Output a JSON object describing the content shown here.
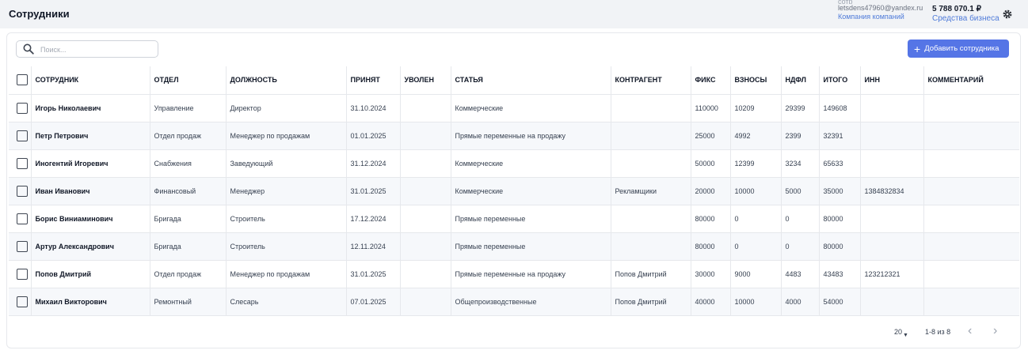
{
  "header": {
    "title": "Сотрудники",
    "account_top": "сотр",
    "email": "letsdens47960@yandex.ru",
    "company_link": "Компания компаний",
    "balance": "5 788 070.1 ₽",
    "funds_link": "Средства бизнеса",
    "settings_icon": "gear-icon"
  },
  "toolbar": {
    "search_placeholder": "Поиск...",
    "search_value": "",
    "add_button": "Добавить сотрудника"
  },
  "table": {
    "columns": [
      "СОТРУДНИК",
      "ОТДЕЛ",
      "ДОЛЖНОСТЬ",
      "ПРИНЯТ",
      "УВОЛЕН",
      "СТАТЬЯ",
      "КОНТРАГЕНТ",
      "ФИКС",
      "ВЗНОСЫ",
      "НДФЛ",
      "ИТОГО",
      "ИНН",
      "КОММЕНТАРИЙ"
    ],
    "rows": [
      [
        "Игорь Николаевич",
        "Управление",
        "Директор",
        "31.10.2024",
        "",
        "Коммерческие",
        "",
        "110000",
        "10209",
        "29399",
        "149608",
        "",
        ""
      ],
      [
        "Петр Петрович",
        "Отдел продаж",
        "Менеджер по продажам",
        "01.01.2025",
        "",
        "Прямые переменные на продажу",
        "",
        "25000",
        "4992",
        "2399",
        "32391",
        "",
        ""
      ],
      [
        "Иногентий Игоревич",
        "Снабжения",
        "Заведующий",
        "31.12.2024",
        "",
        "Коммерческие",
        "",
        "50000",
        "12399",
        "3234",
        "65633",
        "",
        ""
      ],
      [
        "Иван Иванович",
        "Финансовый",
        "Менеджер",
        "31.01.2025",
        "",
        "Коммерческие",
        "Рекламщики",
        "20000",
        "10000",
        "5000",
        "35000",
        "1384832834",
        ""
      ],
      [
        "Борис Виниаминович",
        "Бригада",
        "Строитель",
        "17.12.2024",
        "",
        "Прямые переменные",
        "",
        "80000",
        "0",
        "0",
        "80000",
        "",
        ""
      ],
      [
        "Артур Александрович",
        "Бригада",
        "Строитель",
        "12.11.2024",
        "",
        "Прямые переменные",
        "",
        "80000",
        "0",
        "0",
        "80000",
        "",
        ""
      ],
      [
        "Попов Дмитрий",
        "Отдел продаж",
        "Менеджер по продажам",
        "31.01.2025",
        "",
        "Прямые переменные на продажу",
        "Попов Дмитрий",
        "30000",
        "9000",
        "4483",
        "43483",
        "123212321",
        ""
      ],
      [
        "Михаил Викторович",
        "Ремонтный",
        "Слесарь",
        "07.01.2025",
        "",
        "Общепроизводственные",
        "Попов Дмитрий",
        "40000",
        "10000",
        "4000",
        "54000",
        "",
        ""
      ]
    ]
  },
  "pagination": {
    "per_page": "20",
    "range": "1-8 из 8",
    "prev": "‹",
    "next": "›"
  }
}
